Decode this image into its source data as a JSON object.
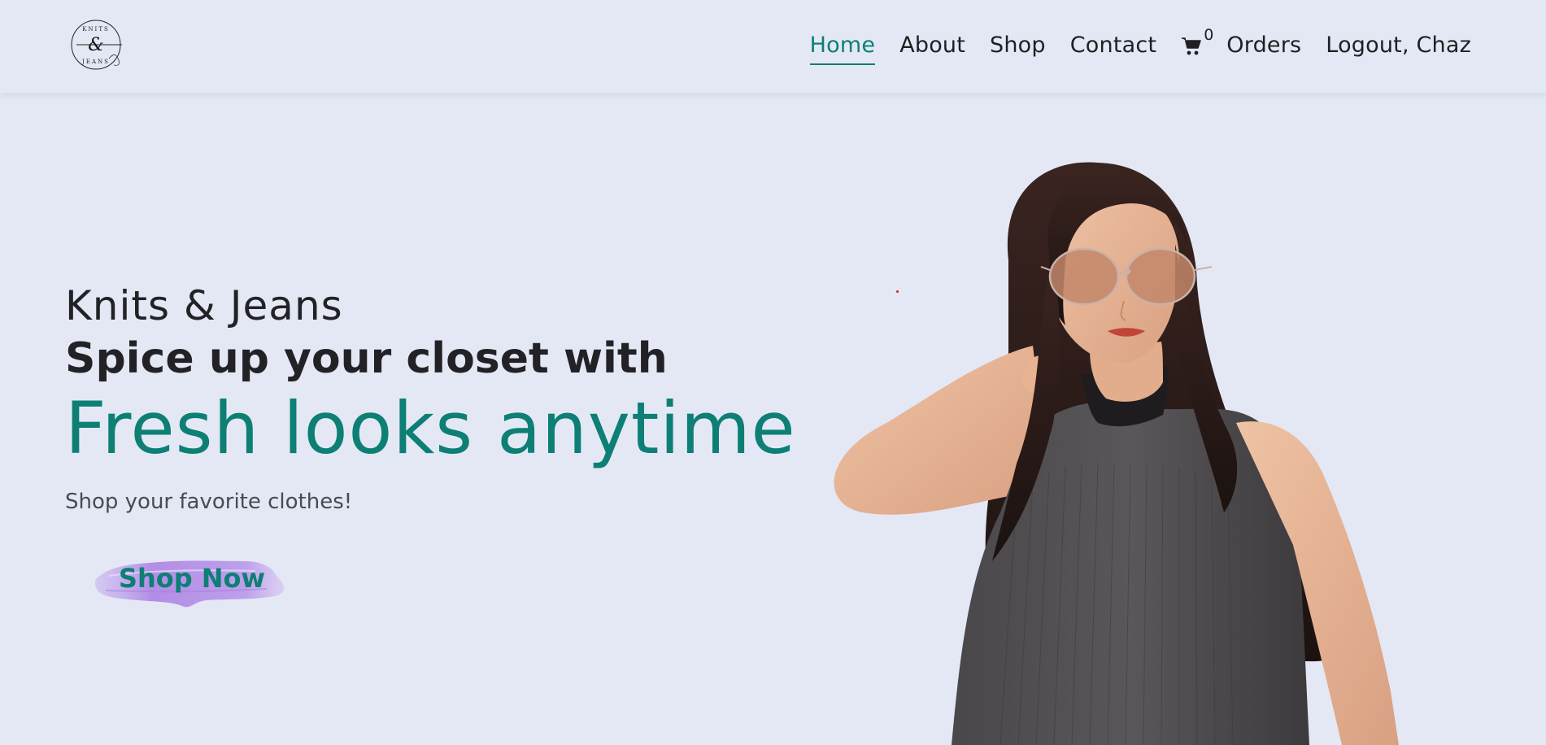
{
  "header": {
    "logo_alt": "Knits & Jeans logo",
    "logo_top_text": "KNITS",
    "logo_bottom_text": "JEANS",
    "nav": [
      {
        "label": "Home",
        "active": true
      },
      {
        "label": "About",
        "active": false
      },
      {
        "label": "Shop",
        "active": false
      },
      {
        "label": "Contact",
        "active": false
      }
    ],
    "cart_count": "0",
    "orders_label": "Orders",
    "logout_label": "Logout, Chaz"
  },
  "hero": {
    "brand": "Knits & Jeans",
    "tagline": "Spice up your closet with",
    "headline": "Fresh looks anytime",
    "subtext": "Shop your favorite clothes!",
    "cta_label": "Shop Now"
  },
  "colors": {
    "background": "#e4e8f5",
    "accent": "#0d7f74",
    "text": "#222226",
    "button_brush": "#b99ae8"
  }
}
